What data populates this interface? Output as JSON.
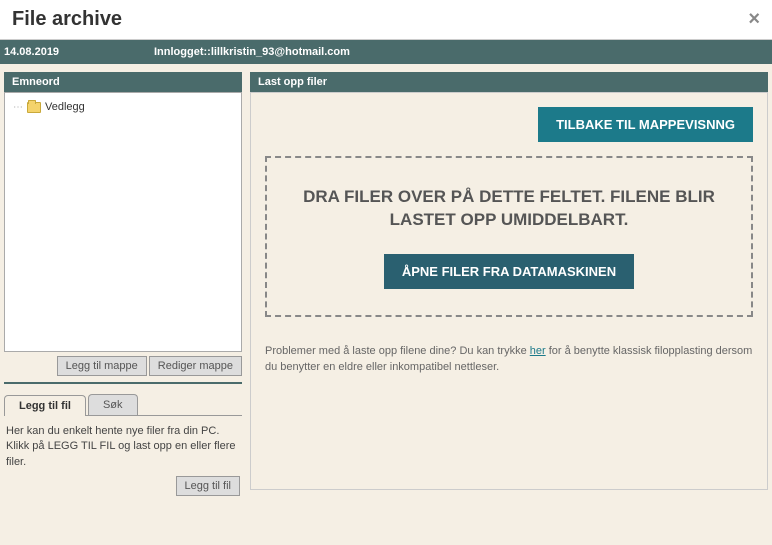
{
  "header": {
    "title": "File archive"
  },
  "infoBar": {
    "date": "14.08.2019",
    "login": "Innlogget::lillkristin_93@hotmail.com"
  },
  "leftPanel": {
    "treeHeader": "Emneord",
    "treeItems": [
      "Vedlegg"
    ],
    "addFolderBtn": "Legg til mappe",
    "editFolderBtn": "Rediger mappe",
    "tabs": {
      "addFile": "Legg til fil",
      "search": "Søk"
    },
    "addFileHelp": "Her kan du enkelt hente nye filer fra din PC. Klikk på LEGG TIL FIL og last opp en eller flere filer.",
    "addFileBtn": "Legg til fil"
  },
  "rightPanel": {
    "header": "Last opp filer",
    "backBtn": "TILBAKE TIL MAPPEVISNNG",
    "dropzoneText": "DRA FILER OVER PÅ DETTE FELTET. FILENE BLIR LASTET OPP UMIDDELBART.",
    "openFilesBtn": "ÅPNE FILER FRA DATAMASKINEN",
    "helpTextBefore": "Problemer med å laste opp filene dine? Du kan trykke ",
    "helpLink": "her",
    "helpTextAfter": " for å benytte klassisk filopplasting dersom du benytter en eldre eller inkompatibel nettleser."
  }
}
